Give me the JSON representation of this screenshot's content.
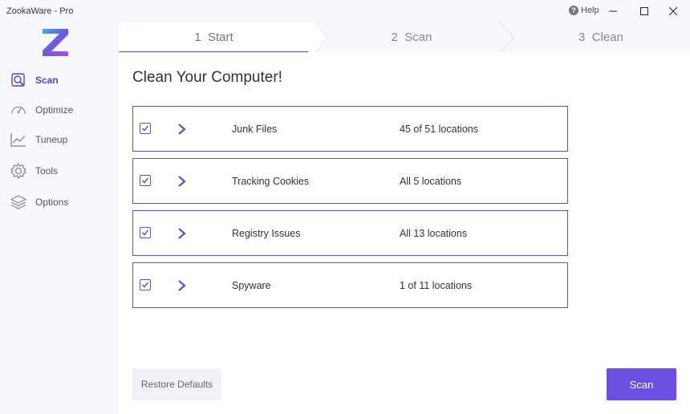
{
  "window": {
    "title": "ZookaWare - Pro",
    "help_label": "Help",
    "help_icon": "help-icon",
    "controls": [
      "minimize-icon",
      "maximize-icon",
      "close-icon"
    ]
  },
  "sidebar": {
    "logo": "zookaware-logo",
    "items": [
      {
        "label": "Scan",
        "icon": "scan-icon",
        "active": true
      },
      {
        "label": "Optimize",
        "icon": "speedometer-icon",
        "active": false
      },
      {
        "label": "Tuneup",
        "icon": "chart-line-icon",
        "active": false
      },
      {
        "label": "Tools",
        "icon": "gear-icon",
        "active": false
      },
      {
        "label": "Options",
        "icon": "layers-icon",
        "active": false
      }
    ]
  },
  "steps": [
    {
      "number": "1",
      "label": "Start",
      "active": true
    },
    {
      "number": "2",
      "label": "Scan",
      "active": false
    },
    {
      "number": "3",
      "label": "Clean",
      "active": false
    }
  ],
  "main": {
    "title": "Clean Your Computer!",
    "rows": [
      {
        "label": "Junk Files",
        "value": "45 of 51 locations",
        "checked": true
      },
      {
        "label": "Tracking Cookies",
        "value": "All 5 locations",
        "checked": true
      },
      {
        "label": "Registry Issues",
        "value": "All 13 locations",
        "checked": true
      },
      {
        "label": "Spyware",
        "value": "1 of 11 locations",
        "checked": true
      }
    ],
    "restore_label": "Restore Defaults",
    "scan_label": "Scan"
  },
  "colors": {
    "accent": "#5b50c9",
    "button": "#6a4fe0",
    "sidebar_bg": "#f7f8fc"
  }
}
